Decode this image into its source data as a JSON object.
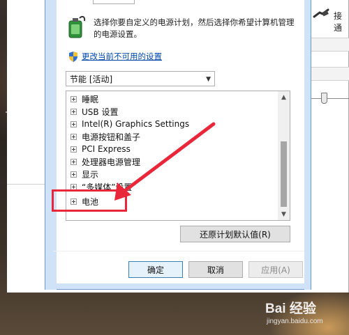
{
  "dialog": {
    "description": "选择你要自定义的电源计划，然后选择你希望计算机管理的电源设置。",
    "change_link": "更改当前不可用的设置",
    "plan_select": "节能 [活动]",
    "tree_items": [
      {
        "label": "睡眠",
        "icon": "expand-plus-icon"
      },
      {
        "label": "USB 设置",
        "icon": "expand-plus-icon"
      },
      {
        "label": "Intel(R) Graphics Settings",
        "icon": "expand-plus-icon"
      },
      {
        "label": "电源按钮和盖子",
        "icon": "expand-plus-icon"
      },
      {
        "label": "PCI Express",
        "icon": "expand-plus-icon"
      },
      {
        "label": "处理器电源管理",
        "icon": "expand-plus-icon"
      },
      {
        "label": "显示",
        "icon": "expand-plus-icon"
      },
      {
        "label": "“多媒体”设置",
        "icon": "expand-plus-icon"
      },
      {
        "label": "电池",
        "icon": "expand-plus-icon"
      }
    ],
    "restore_button": "还原计划默认值(R)",
    "ok_button": "确定",
    "cancel_button": "取消",
    "apply_button": "应用(A)"
  },
  "background_window": {
    "partial_text": "接通"
  },
  "annotation": {
    "highlight_color": "#e8283a",
    "highlighted_item": "电池"
  },
  "watermark": {
    "logo": "Bai 经验",
    "url": "jingyan.baidu.com"
  },
  "colors": {
    "link": "#0047ab",
    "dialog_frame": "#cfe2f7",
    "button_primary_border": "#3c7fb1"
  }
}
